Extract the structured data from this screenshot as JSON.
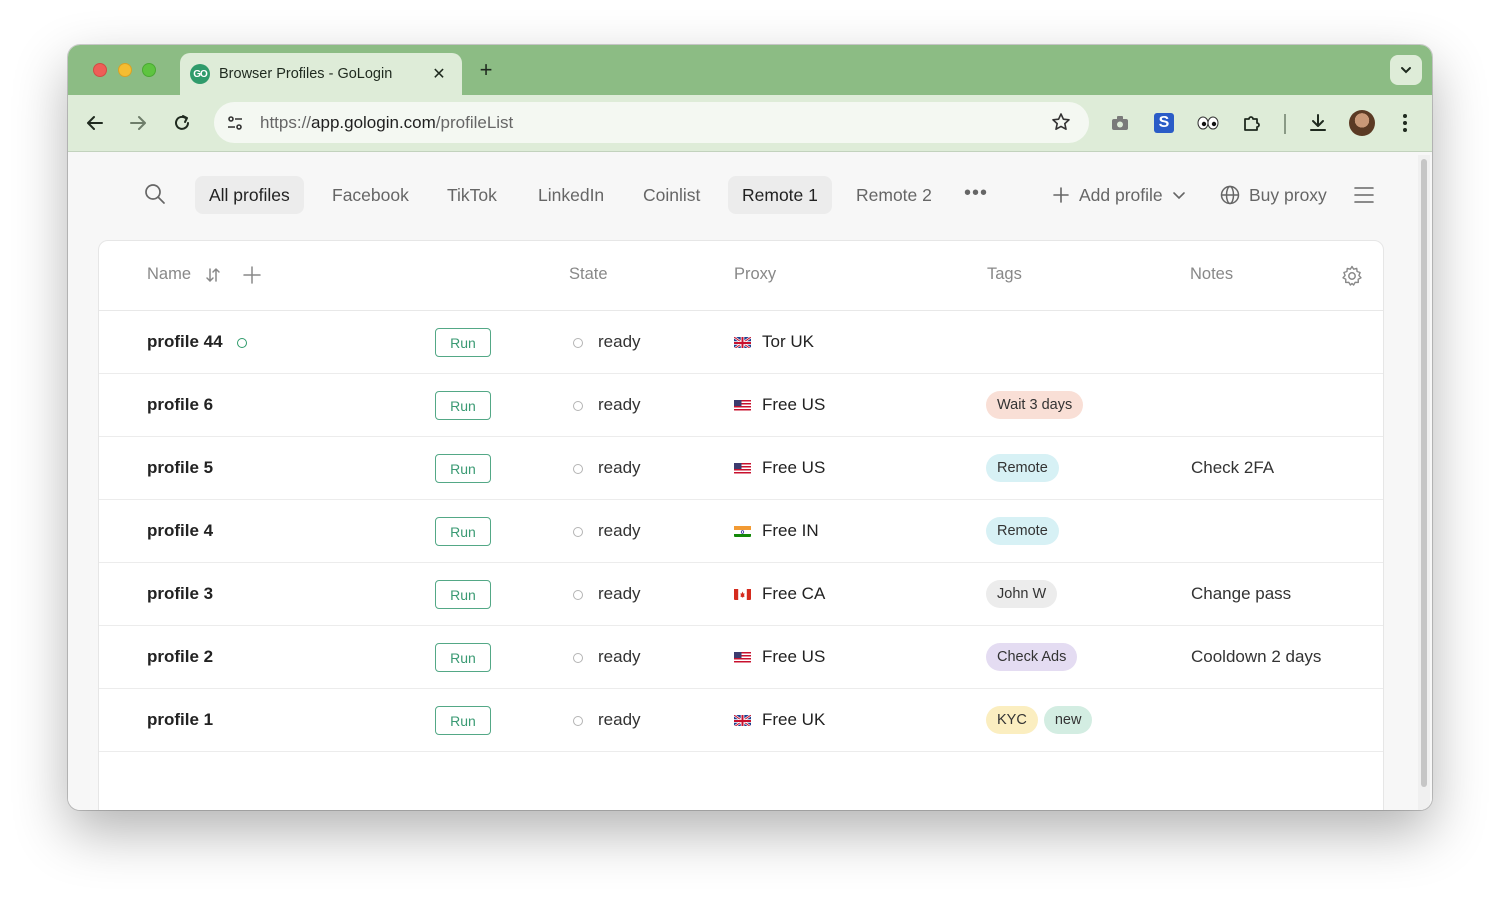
{
  "browser": {
    "tab_title": "Browser Profiles - GoLogin",
    "tab_logo_text": "GO",
    "url_scheme": "https://",
    "url_host": "app.gologin.com",
    "url_path": "/profileList"
  },
  "filters": {
    "tabs": [
      {
        "label": "All profiles",
        "active": true
      },
      {
        "label": "Facebook",
        "active": false
      },
      {
        "label": "TikTok",
        "active": false
      },
      {
        "label": "LinkedIn",
        "active": false
      },
      {
        "label": "Coinlist",
        "active": false
      },
      {
        "label": "Remote 1",
        "active": true
      },
      {
        "label": "Remote 2",
        "active": false
      }
    ],
    "more_label": "•••",
    "add_profile_label": "Add profile",
    "buy_proxy_label": "Buy proxy"
  },
  "table": {
    "headers": {
      "name": "Name",
      "state": "State",
      "proxy": "Proxy",
      "tags": "Tags",
      "notes": "Notes"
    },
    "run_label": "Run",
    "rows": [
      {
        "name": "profile 44",
        "state": "ready",
        "flag": "uk",
        "proxy": "Tor UK",
        "tags": [],
        "note": ""
      },
      {
        "name": "profile 6",
        "state": "ready",
        "flag": "us",
        "proxy": "Free US",
        "tags": [
          {
            "label": "Wait 3 days",
            "color": "#f9dfd6"
          }
        ],
        "note": ""
      },
      {
        "name": "profile 5",
        "state": "ready",
        "flag": "us",
        "proxy": "Free US",
        "tags": [
          {
            "label": "Remote",
            "color": "#d7f1f5"
          }
        ],
        "note": "Check 2FA"
      },
      {
        "name": "profile 4",
        "state": "ready",
        "flag": "in",
        "proxy": "Free IN",
        "tags": [
          {
            "label": "Remote",
            "color": "#d7f1f5"
          }
        ],
        "note": ""
      },
      {
        "name": "profile 3",
        "state": "ready",
        "flag": "ca",
        "proxy": "Free CA",
        "tags": [
          {
            "label": "John W",
            "color": "#ececec"
          }
        ],
        "note": "Change pass"
      },
      {
        "name": "profile 2",
        "state": "ready",
        "flag": "us",
        "proxy": "Free US",
        "tags": [
          {
            "label": "Check Ads",
            "color": "#e4dcf2"
          }
        ],
        "note": "Cooldown 2 days"
      },
      {
        "name": "profile 1",
        "state": "ready",
        "flag": "uk",
        "proxy": "Free UK",
        "tags": [
          {
            "label": "KYC",
            "color": "#fbeec0"
          },
          {
            "label": "new",
            "color": "#d3ede2"
          }
        ],
        "note": ""
      }
    ]
  },
  "colors": {
    "accent": "#3fa17b",
    "chrome_frame": "#8cbc84",
    "chrome_toolbar": "#deecd8"
  },
  "icons": [
    "search-icon",
    "sort-icon",
    "plus-icon",
    "gear-icon",
    "globe-icon",
    "hamburger-menu-icon",
    "chat-icon"
  ]
}
